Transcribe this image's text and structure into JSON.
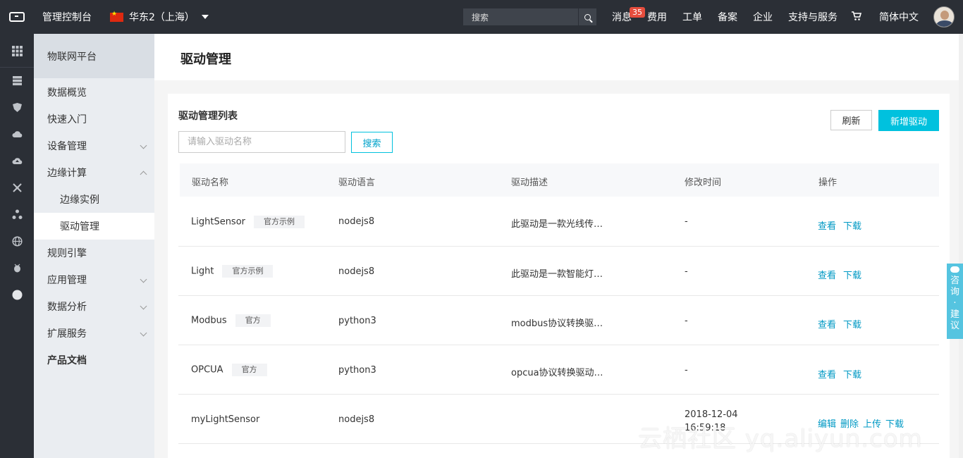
{
  "topbar": {
    "console_title": "管理控制台",
    "region": "华东2（上海）",
    "search_placeholder": "搜索",
    "messages_label": "消息",
    "messages_count": "35",
    "nav": [
      "费用",
      "工单",
      "备案",
      "企业",
      "支持与服务"
    ],
    "language": "简体中文"
  },
  "sidebar": {
    "header": "物联网平台",
    "items": [
      {
        "label": "数据概览"
      },
      {
        "label": "快速入门"
      },
      {
        "label": "设备管理"
      },
      {
        "label": "边缘计算"
      },
      {
        "label": "边缘实例"
      },
      {
        "label": "驱动管理"
      },
      {
        "label": "规则引擎"
      },
      {
        "label": "应用管理"
      },
      {
        "label": "数据分析"
      },
      {
        "label": "扩展服务"
      },
      {
        "label": "产品文档"
      }
    ]
  },
  "page": {
    "title": "驱动管理",
    "list_title": "驱动管理列表",
    "search_input_placeholder": "请输入驱动名称",
    "search_button": "搜索",
    "refresh_button": "刷新",
    "new_button": "新增驱动"
  },
  "table": {
    "columns": [
      "驱动名称",
      "驱动语言",
      "驱动描述",
      "修改时间",
      "操作"
    ],
    "rows": [
      {
        "name": "LightSensor",
        "tag": "官方示例",
        "language": "nodejs8",
        "description": "此驱动是一款光线传…",
        "modified": "-",
        "actions": [
          "查看",
          "下载"
        ]
      },
      {
        "name": "Light",
        "tag": "官方示例",
        "language": "nodejs8",
        "description": "此驱动是一款智能灯…",
        "modified": "-",
        "actions": [
          "查看",
          "下载"
        ]
      },
      {
        "name": "Modbus",
        "tag": "官方",
        "language": "python3",
        "description": "modbus协议转换驱…",
        "modified": "-",
        "actions": [
          "查看",
          "下载"
        ]
      },
      {
        "name": "OPCUA",
        "tag": "官方",
        "language": "python3",
        "description": "opcua协议转换驱动…",
        "modified": "-",
        "actions": [
          "查看",
          "下载"
        ]
      },
      {
        "name": "myLightSensor",
        "tag": "",
        "language": "nodejs8",
        "description": "",
        "modified_date": "2018-12-04",
        "modified_time": "16:59:18",
        "actions": [
          "编辑",
          "删除",
          "上传",
          "下载"
        ]
      }
    ]
  },
  "float_advice": [
    "咨",
    "询",
    "·",
    "建",
    "议"
  ],
  "watermark": "云栖社区 yq.aliyun.com"
}
